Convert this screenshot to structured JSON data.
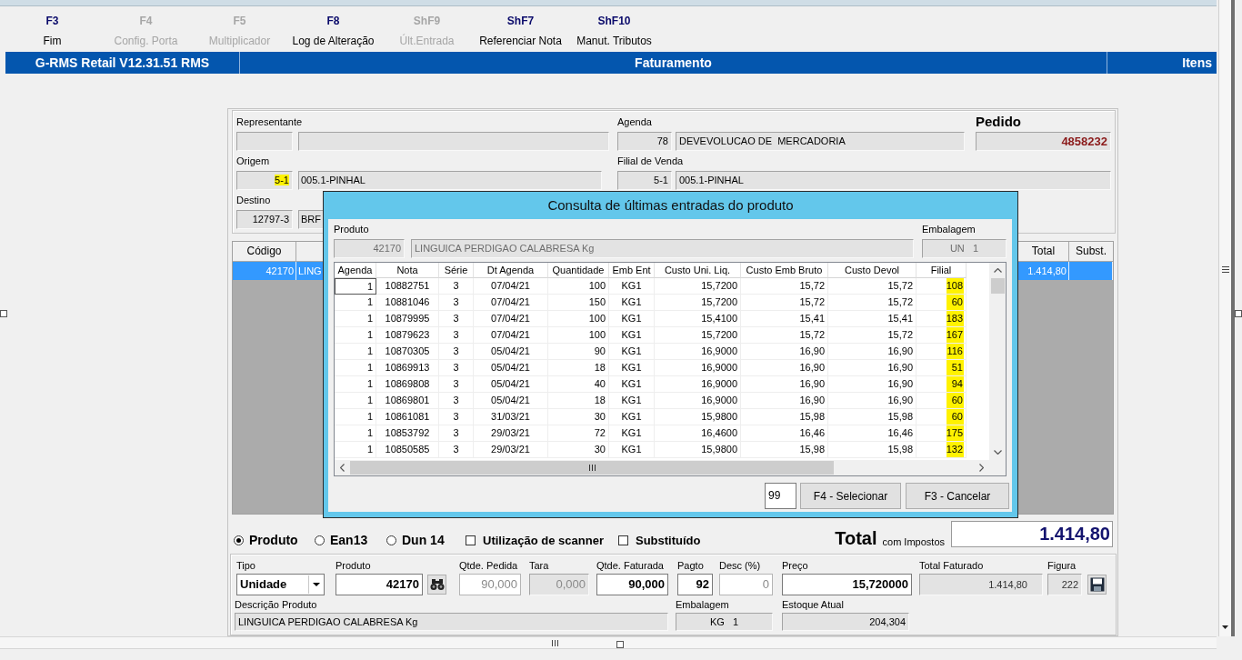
{
  "toolbar": [
    {
      "key": "F3",
      "label": "Fim",
      "disabled": false
    },
    {
      "key": "F4",
      "label": "Config. Porta",
      "disabled": true
    },
    {
      "key": "F5",
      "label": "Multiplicador",
      "disabled": true
    },
    {
      "key": "F8",
      "label": "Log de Alteração",
      "disabled": false
    },
    {
      "key": "ShF9",
      "label": "Últ.Entrada",
      "disabled": true
    },
    {
      "key": "ShF7",
      "label": "Referenciar Nota",
      "disabled": false
    },
    {
      "key": "ShF10",
      "label": "Manut. Tributos",
      "disabled": false
    }
  ],
  "title_bar": {
    "application": "G-RMS Retail V12.31.51 RMS",
    "screen": "Faturamento",
    "panel": "Itens"
  },
  "order_header": {
    "representante": {
      "label": "Representante"
    },
    "agenda": {
      "label": "Agenda",
      "code": "78",
      "name": "DEVEVOLUCAO DE  MERCADORIA"
    },
    "pedido": {
      "label": "Pedido",
      "number": "4858232"
    },
    "origem": {
      "label": "Origem",
      "code": "5-1",
      "code_highlighted": true,
      "name": "005.1-PINHAL"
    },
    "filial_de_venda": {
      "label": "Filial de Venda",
      "code": "5-1",
      "name": "005.1-PINHAL"
    },
    "destino": {
      "label": "Destino",
      "code": "12797-3",
      "name": "BRF"
    }
  },
  "items_table": {
    "columns": [
      "Código",
      "Total",
      "Subst."
    ],
    "rows": [
      {
        "codigo": "42170",
        "column_2": "LING",
        "total": "1.414,80",
        "selected": true
      }
    ]
  },
  "search_mode": {
    "options": [
      {
        "label": "Produto",
        "selected": true
      },
      {
        "label": "Ean13",
        "selected": false
      },
      {
        "label": "Dun 14",
        "selected": false
      }
    ],
    "checkboxes": [
      {
        "label": "Utilização de scanner",
        "checked": false
      },
      {
        "label": "Substituído",
        "checked": false
      }
    ]
  },
  "total": {
    "label": "Total",
    "note": "com Impostos",
    "value": "1.414,80"
  },
  "item_entry": {
    "fields": [
      {
        "label": "Tipo",
        "value": "Unidade",
        "kind": "select"
      },
      {
        "label": "Produto",
        "value": "42170",
        "kind": "input"
      },
      {
        "kind": "lookup"
      },
      {
        "label": "Qtde. Pedida",
        "value": "90,000",
        "kind": "disabled"
      },
      {
        "label": "Tara",
        "value": "0,000",
        "kind": "readonly_dim"
      },
      {
        "label": "Qtde. Faturada",
        "value": "90,000",
        "kind": "input"
      },
      {
        "label": "Pagto",
        "value": "92",
        "kind": "input"
      },
      {
        "label": "Desc (%)",
        "value": "0",
        "kind": "disabled"
      },
      {
        "label": "Preço",
        "value": "15,720000",
        "kind": "input"
      },
      {
        "label": "Total Faturado",
        "value": "1.414,80",
        "kind": "readonly"
      },
      {
        "label": "Figura",
        "value": "222",
        "kind": "readonly"
      },
      {
        "kind": "save"
      }
    ],
    "info": [
      {
        "label": "Descrição Produto",
        "value": "LINGUICA PERDIGAO CALABRESA Kg"
      },
      {
        "label": "Embalagem",
        "value": "KG   1"
      },
      {
        "label": "Estoque Atual",
        "value": "204,304"
      }
    ]
  },
  "dialog": {
    "title": "Consulta de últimas entradas do produto",
    "produto": {
      "label": "Produto",
      "code": "42170",
      "description": "LINGUICA PERDIGAO CALABRESA Kg"
    },
    "embalagem": {
      "label": "Embalagem",
      "value": "UN   1"
    },
    "table": {
      "columns": [
        {
          "label": "Agenda",
          "highlighted": false
        },
        {
          "label": "Nota",
          "highlighted": false
        },
        {
          "label": "Série",
          "highlighted": false
        },
        {
          "label": "Dt Agenda",
          "highlighted": false
        },
        {
          "label": "Quantidade",
          "highlighted": false
        },
        {
          "label": "Emb Ent",
          "highlighted": false
        },
        {
          "label": "Custo Uni. Liq.",
          "highlighted": false
        },
        {
          "label": "Custo Emb Bruto",
          "highlighted": false
        },
        {
          "label": "Custo Devol",
          "highlighted": false
        },
        {
          "label": "Filial",
          "highlighted": true
        }
      ],
      "rows": [
        {
          "cells": [
            "1",
            "10882751",
            "3",
            "07/04/21",
            "100",
            "KG1",
            "15,7200",
            "15,72",
            "15,72",
            "108"
          ],
          "focused": true
        },
        {
          "cells": [
            "1",
            "10881046",
            "3",
            "07/04/21",
            "150",
            "KG1",
            "15,7200",
            "15,72",
            "15,72",
            "60"
          ],
          "focused": false
        },
        {
          "cells": [
            "1",
            "10879995",
            "3",
            "07/04/21",
            "100",
            "KG1",
            "15,4100",
            "15,41",
            "15,41",
            "183"
          ],
          "focused": false
        },
        {
          "cells": [
            "1",
            "10879623",
            "3",
            "07/04/21",
            "100",
            "KG1",
            "15,7200",
            "15,72",
            "15,72",
            "167"
          ],
          "focused": false
        },
        {
          "cells": [
            "1",
            "10870305",
            "3",
            "05/04/21",
            "90",
            "KG1",
            "16,9000",
            "16,90",
            "16,90",
            "116"
          ],
          "focused": false
        },
        {
          "cells": [
            "1",
            "10869913",
            "3",
            "05/04/21",
            "18",
            "KG1",
            "16,9000",
            "16,90",
            "16,90",
            "51"
          ],
          "focused": false
        },
        {
          "cells": [
            "1",
            "10869808",
            "3",
            "05/04/21",
            "40",
            "KG1",
            "16,9000",
            "16,90",
            "16,90",
            "94"
          ],
          "focused": false
        },
        {
          "cells": [
            "1",
            "10869801",
            "3",
            "05/04/21",
            "18",
            "KG1",
            "16,9000",
            "16,90",
            "16,90",
            "60"
          ],
          "focused": false
        },
        {
          "cells": [
            "1",
            "10861081",
            "3",
            "31/03/21",
            "30",
            "KG1",
            "15,9800",
            "15,98",
            "15,98",
            "60"
          ],
          "focused": false
        },
        {
          "cells": [
            "1",
            "10853792",
            "3",
            "29/03/21",
            "72",
            "KG1",
            "16,4600",
            "16,46",
            "16,46",
            "175"
          ],
          "focused": false
        },
        {
          "cells": [
            "1",
            "10850585",
            "3",
            "29/03/21",
            "30",
            "KG1",
            "15,9800",
            "15,98",
            "15,98",
            "132"
          ],
          "focused": false
        }
      ]
    },
    "count": "99",
    "buttons": [
      {
        "label": "F4 - Selecionar"
      },
      {
        "label": "F3 - Cancelar"
      }
    ]
  }
}
